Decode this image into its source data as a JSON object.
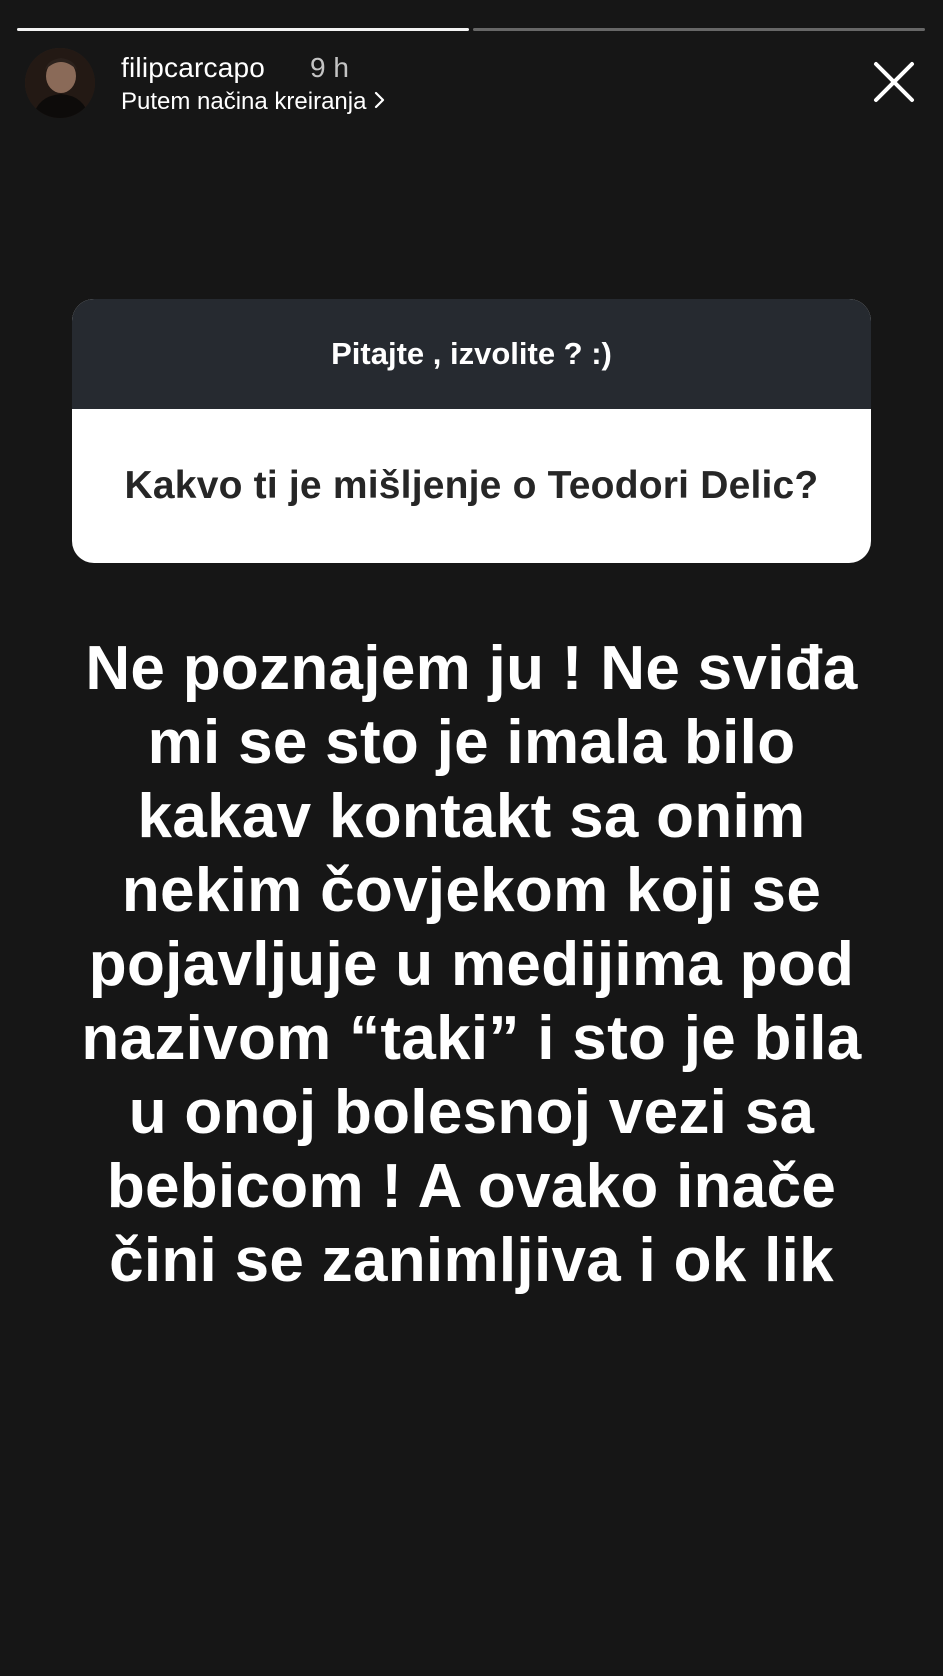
{
  "story": {
    "progress": {
      "segments": 2,
      "completed": 1
    }
  },
  "header": {
    "username": "filipcarcapo",
    "time_ago": "9 h",
    "subtitle": "Putem načina kreiranja",
    "subtitle_icon": "chevron-right-icon",
    "close_icon": "close-icon"
  },
  "question_sticker": {
    "prompt": "Pitajte , izvolite ? :)",
    "question": "Kakvo ti je mišljenje o Teodori Delic?",
    "header_color": "#262a30"
  },
  "answer": {
    "lines": [
      "Ne poznajem ju ! Ne sviđa",
      "mi se sto je imala bilo",
      "kakav kontakt sa onim",
      "nekim čovjekom koji se",
      "pojavljuje u medijima pod",
      "nazivom “taki” i sto je bila",
      "u onoj bolesnoj vezi sa",
      "bebicom ! A ovako inače",
      "čini se zanimljiva i ok lik"
    ]
  },
  "colors": {
    "background": "#161616",
    "text": "#ffffff"
  }
}
